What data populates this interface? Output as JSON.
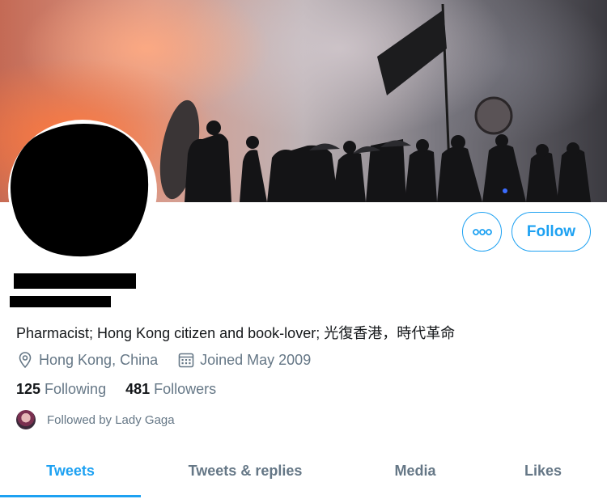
{
  "profile": {
    "bio": "Pharmacist; Hong Kong citizen and book-lover; 光復香港，時代革命",
    "location": "Hong Kong, China",
    "joined": "Joined May 2009",
    "location_icon": "map-pin-icon",
    "joined_icon": "calendar-icon"
  },
  "stats": {
    "following_count": "125",
    "following_label": "Following",
    "followers_count": "481",
    "followers_label": "Followers"
  },
  "followed_by": {
    "text": "Followed by Lady Gaga"
  },
  "actions": {
    "more_icon": "more-options-icon",
    "follow_label": "Follow"
  },
  "tabs": [
    {
      "label": "Tweets",
      "active": true
    },
    {
      "label": "Tweets & replies",
      "active": false
    },
    {
      "label": "Media",
      "active": false
    },
    {
      "label": "Likes",
      "active": false
    }
  ],
  "colors": {
    "accent": "#1da1f2",
    "secondary_text": "#657786",
    "primary_text": "#14171a"
  }
}
